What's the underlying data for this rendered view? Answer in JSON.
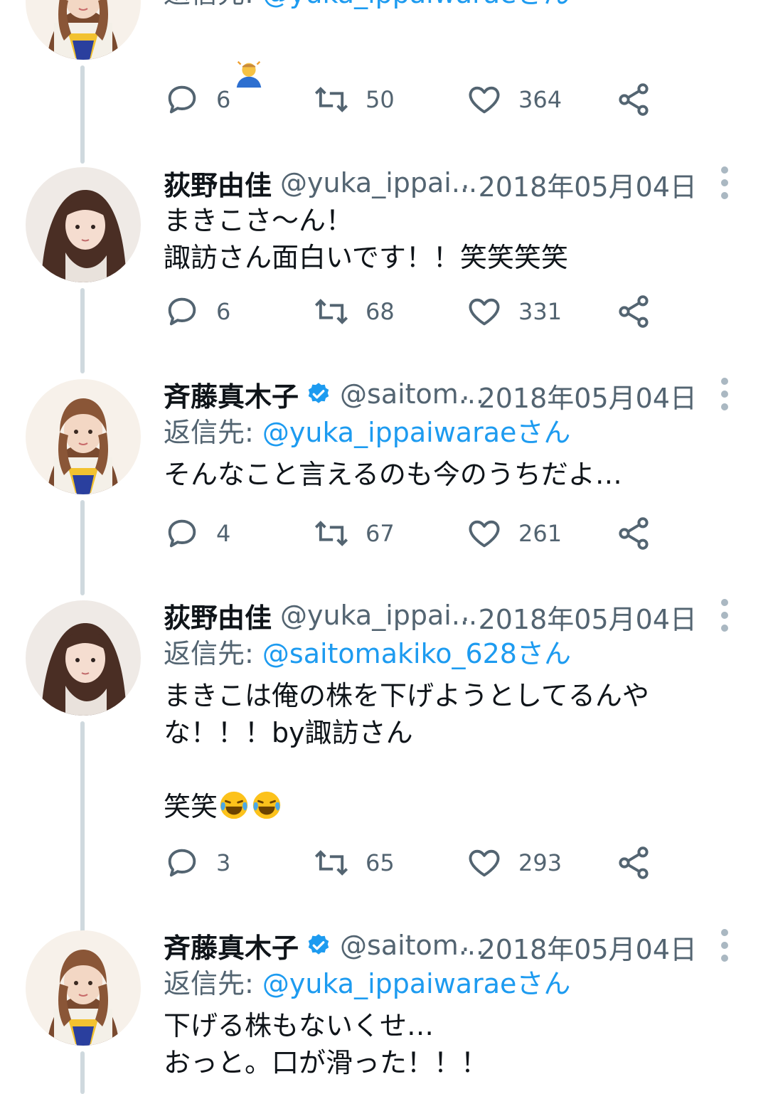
{
  "tweets": [
    {
      "id": "t0",
      "reply_prefix": "返信先: ",
      "reply_mention": "@yuka_ippaiwaraeさん",
      "emoji": "man-bowing",
      "counts": {
        "reply": "6",
        "retweet": "50",
        "like": "364"
      }
    },
    {
      "id": "t1",
      "name": "荻野由佳",
      "handle": "@yuka_ippai...",
      "time": "· 2018年05月04日",
      "text": "まきこさ〜ん！\n諏訪さん面白いです！！笑笑笑笑",
      "counts": {
        "reply": "6",
        "retweet": "68",
        "like": "331"
      }
    },
    {
      "id": "t2",
      "name": "斉藤真木子",
      "verified": true,
      "handle": "@saitom...",
      "time": "· 2018年05月04日",
      "reply_prefix": "返信先: ",
      "reply_mention": "@yuka_ippaiwaraeさん",
      "text": "そんなこと言えるのも今のうちだよ…",
      "counts": {
        "reply": "4",
        "retweet": "67",
        "like": "261"
      }
    },
    {
      "id": "t3",
      "name": "荻野由佳",
      "handle": "@yuka_ippai...",
      "time": "· 2018年05月04日",
      "reply_prefix": "返信先: ",
      "reply_mention": "@saitomakiko_628さん",
      "text": "まきこは俺の株を下げようとしてるんや\nな！！！by諏訪さん\n\n笑笑",
      "emoji": "face-with-tears-of-joy x2",
      "counts": {
        "reply": "3",
        "retweet": "65",
        "like": "293"
      }
    },
    {
      "id": "t4",
      "name": "斉藤真木子",
      "verified": true,
      "handle": "@saitom...",
      "time": "· 2018年05月04日",
      "reply_prefix": "返信先: ",
      "reply_mention": "@yuka_ippaiwaraeさん",
      "text": "下げる株もないくせ…\nおっと。口が滑った！！！"
    }
  ],
  "icons": [
    "reply-icon",
    "retweet-icon",
    "like-icon",
    "share-icon",
    "more-icon",
    "verified-badge-icon"
  ],
  "colors": {
    "accent": "#1d9bf0",
    "muted": "#536471",
    "text": "#0f1419",
    "thread_line": "#cfd9de"
  }
}
